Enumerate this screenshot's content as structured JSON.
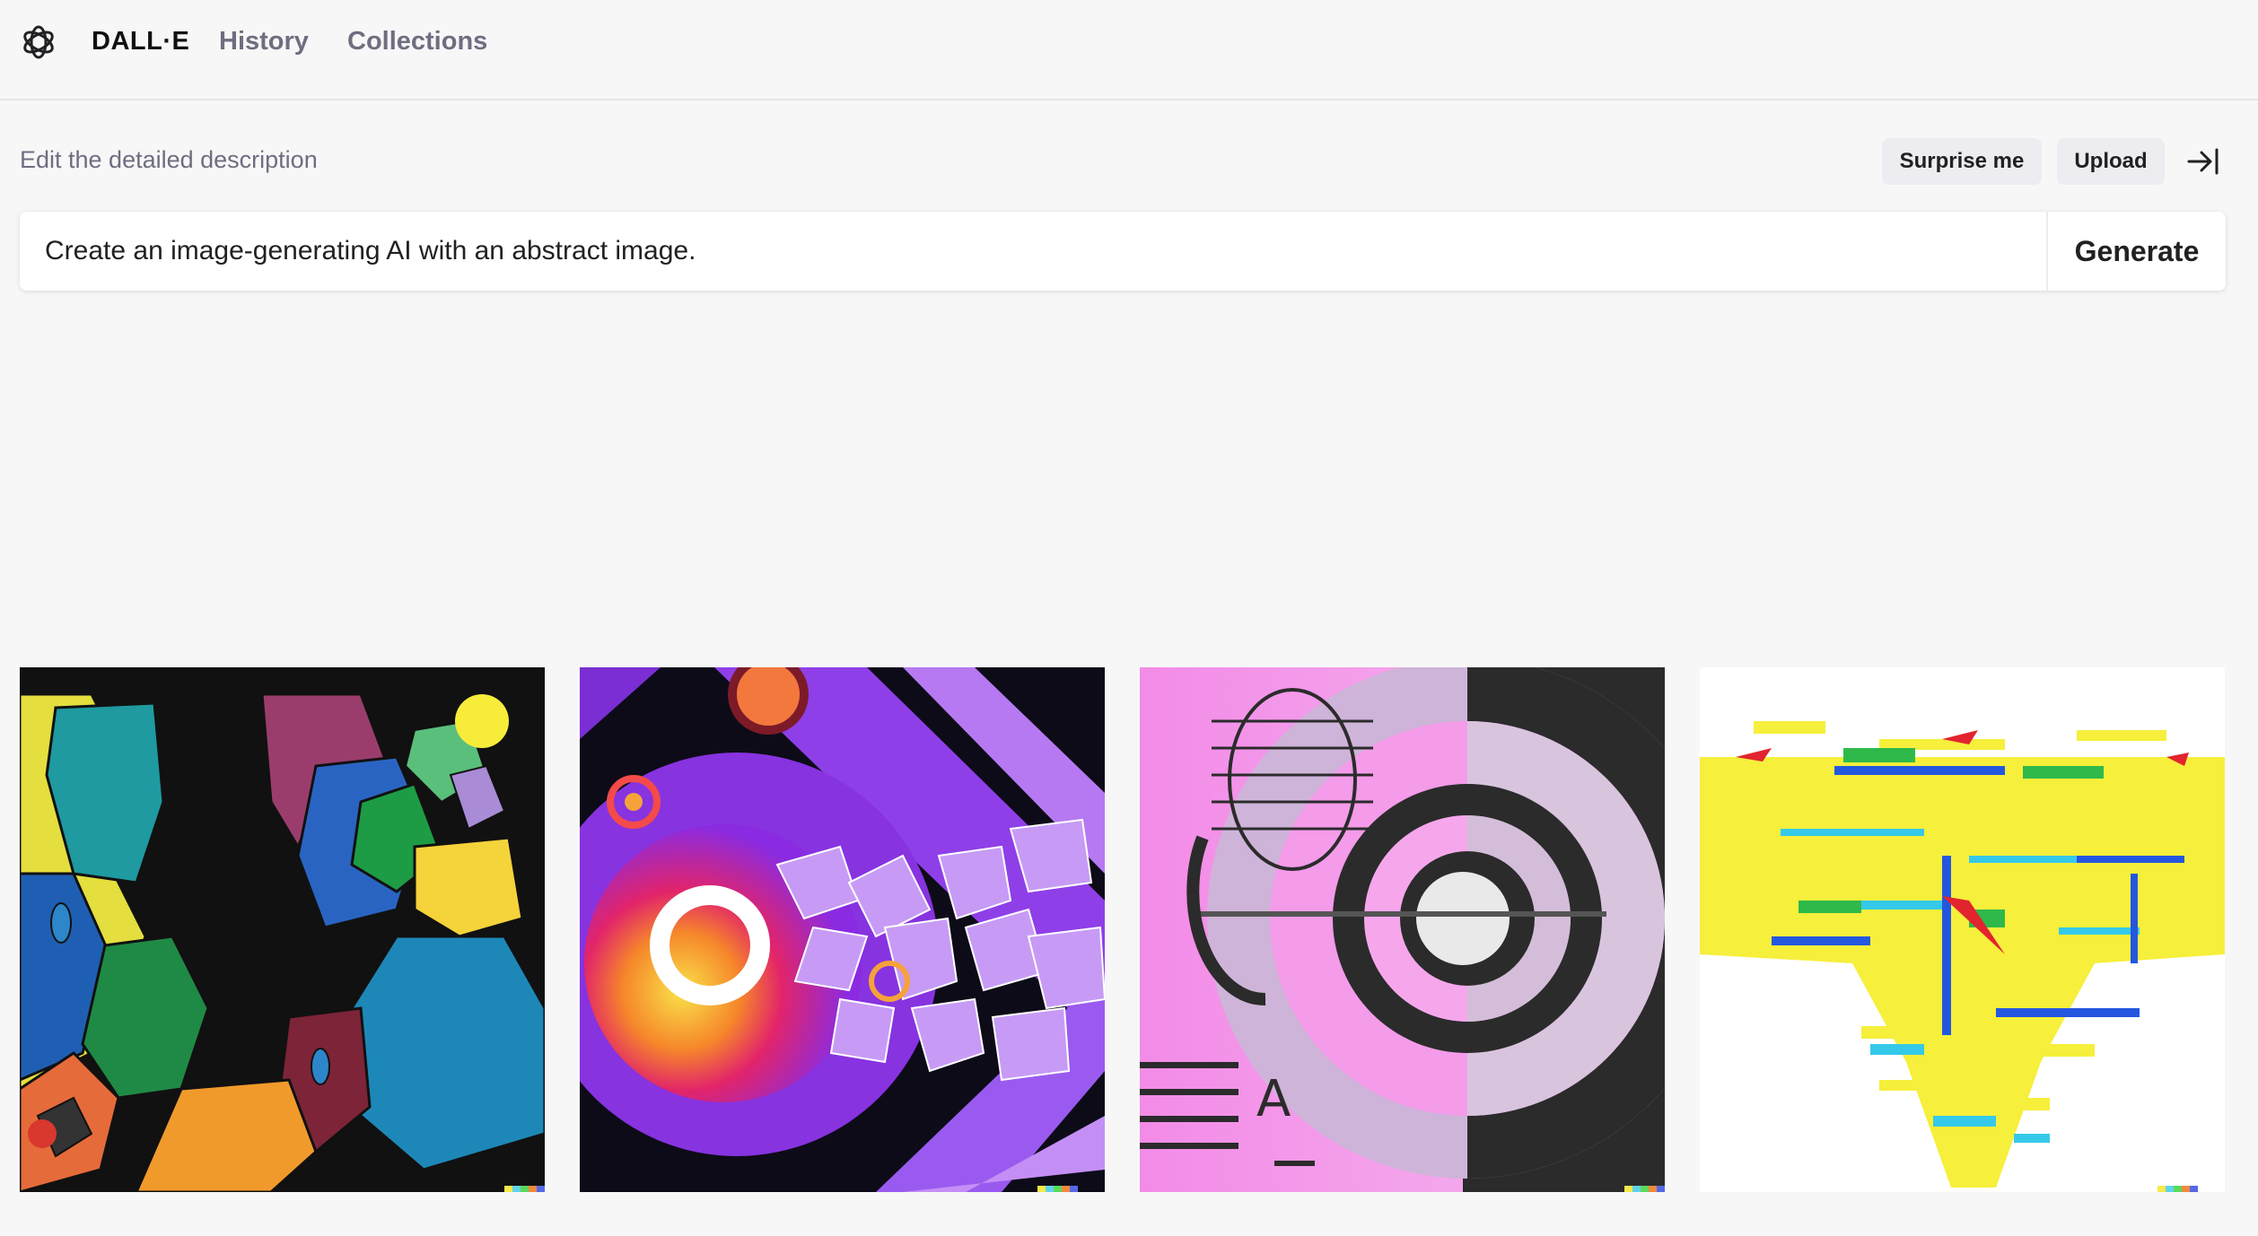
{
  "nav": {
    "brand": "DALL·E",
    "history": "History",
    "collections": "Collections"
  },
  "prompt": {
    "label": "Edit the detailed description",
    "value": "Create an image-generating AI with an abstract image.",
    "surprise_label": "Surprise me",
    "upload_label": "Upload",
    "generate_label": "Generate"
  },
  "icons": {
    "logo": "openai-logo-icon",
    "collapse": "arrow-right-to-bar-icon"
  },
  "colors": {
    "background": "#f7f7f8",
    "chip": "#ececf1",
    "muted_text": "#6e6e80",
    "watermark": [
      "#f5e94a",
      "#61d3e8",
      "#5bd95d",
      "#f08a3c",
      "#5768e6"
    ]
  },
  "images": [
    {
      "alt": "abstract colorful blob painting"
    },
    {
      "alt": "purple abstract circle with geometric shards"
    },
    {
      "alt": "pink concentric circles with letter A"
    },
    {
      "alt": "yellow glitch abstract"
    }
  ]
}
